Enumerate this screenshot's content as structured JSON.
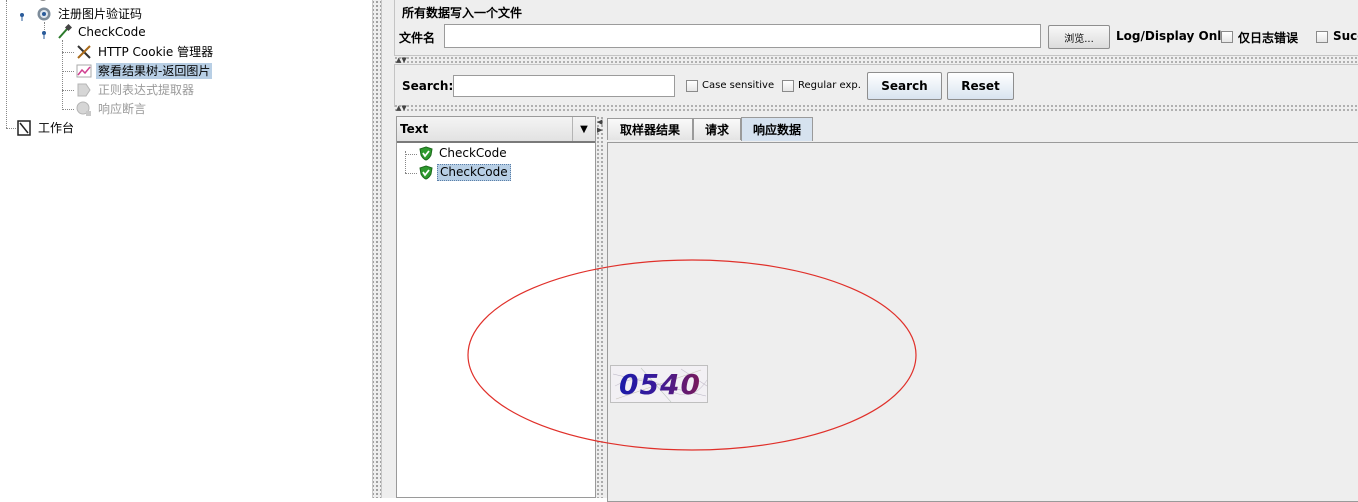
{
  "tree": {
    "items": [
      {
        "label": "注册图片验证码",
        "icon": "gear-icon"
      },
      {
        "label": "CheckCode",
        "icon": "pipette-icon"
      },
      {
        "label": "HTTP Cookie 管理器",
        "icon": "wrench-icon"
      },
      {
        "label": "察看结果树-返回图片",
        "icon": "chart-icon"
      },
      {
        "label": "正则表达式提取器",
        "icon": "extractor-icon"
      },
      {
        "label": "响应断言",
        "icon": "assertion-icon"
      },
      {
        "label": "工作台",
        "icon": "workbench-icon"
      }
    ]
  },
  "file_panel": {
    "title": "所有数据写入一个文件",
    "filename_label": "文件名",
    "filename_value": "",
    "browse_label": "浏览...",
    "log_display_label": "Log/Display Only:",
    "errors_only_label": "仅日志错误",
    "successes_label": "Succ"
  },
  "search": {
    "label": "Search:",
    "value": "",
    "case_sensitive_label": "Case sensitive",
    "regex_label": "Regular exp.",
    "search_button": "Search",
    "reset_button": "Reset"
  },
  "results": {
    "renderer": "Text",
    "samples": [
      {
        "label": "CheckCode",
        "status": "success"
      },
      {
        "label": "CheckCode",
        "status": "success"
      }
    ],
    "tabs": [
      "取样器结果",
      "请求",
      "响应数据"
    ],
    "active_tab": "响应数据",
    "captcha_text": "0540"
  },
  "colors": {
    "selection": "#b8cfe5",
    "success": "#2e9a2e",
    "highlight_ellipse": "#e0302a",
    "captcha_ink": "#1a1aa8"
  }
}
